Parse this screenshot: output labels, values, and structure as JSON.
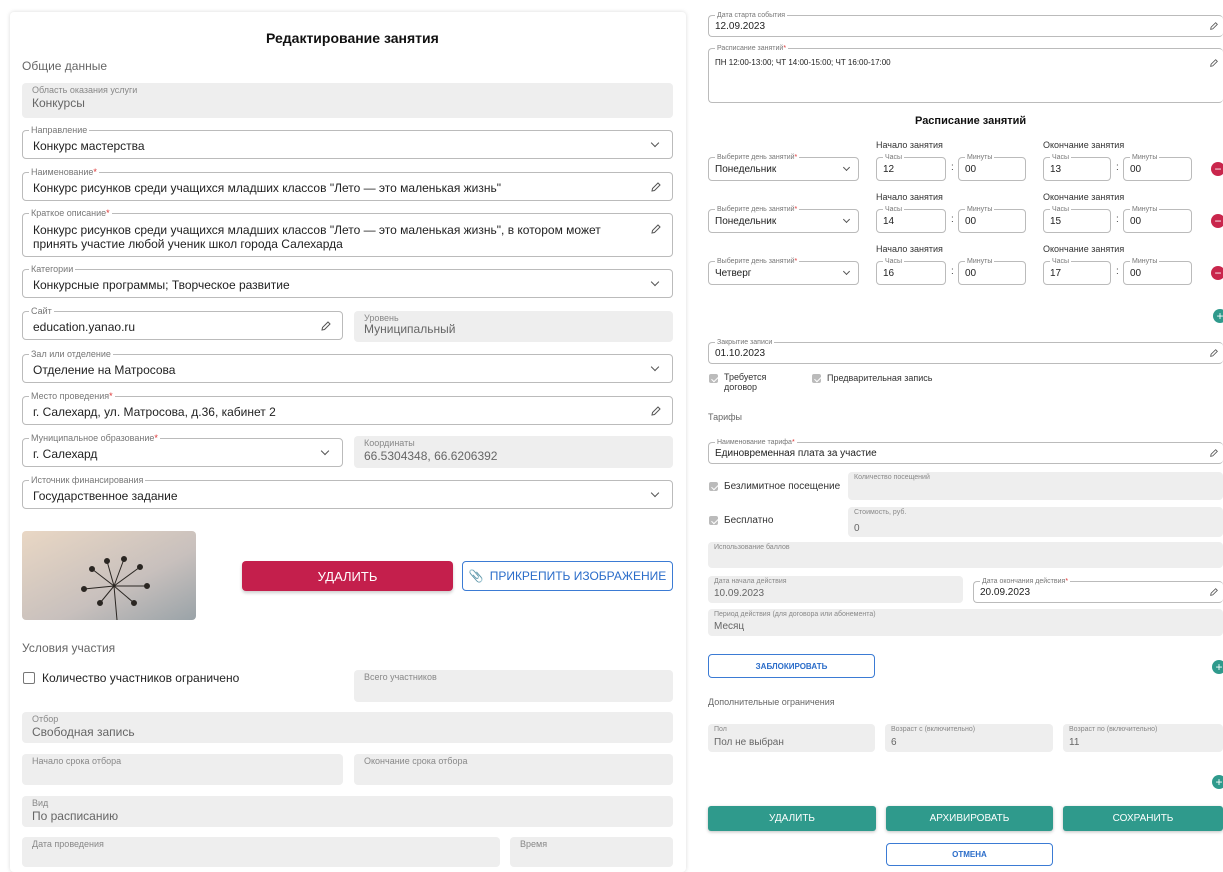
{
  "left": {
    "title": "Редактирование занятия",
    "general_section": "Общие данные",
    "area": {
      "label": "Область оказания услуги",
      "value": "Конкурсы"
    },
    "direction": {
      "label": "Направление",
      "value": "Конкурс мастерства"
    },
    "name": {
      "label": "Наименование",
      "value": "Конкурс рисунков среди учащихся младших классов \"Лето — это маленькая жизнь\""
    },
    "short_desc": {
      "label": "Краткое описание",
      "value": "Конкурс рисунков среди учащихся младших классов \"Лето — это маленькая жизнь\", в котором может принять участие любой ученик школ города Салехарда"
    },
    "categories": {
      "label": "Категории",
      "value": "Конкурсные программы; Творческое развитие"
    },
    "site": {
      "label": "Сайт",
      "value": "education.yanao.ru"
    },
    "level": {
      "label": "Уровень",
      "value": "Муниципальный"
    },
    "hall": {
      "label": "Зал или отделение",
      "value": "Отделение на Матросова"
    },
    "place": {
      "label": "Место проведения",
      "value": "г. Салехард, ул. Матросова, д.36, кабинет 2"
    },
    "municipality": {
      "label": "Муниципальное образование",
      "value": "г. Салехард"
    },
    "coords": {
      "label": "Координаты",
      "value": "66.5304348, 66.6206392"
    },
    "funding": {
      "label": "Источник финансирования",
      "value": "Государственное задание"
    },
    "delete_btn": "УДАЛИТЬ",
    "attach_btn": "ПРИКРЕПИТЬ ИЗОБРАЖЕНИЕ",
    "conditions_section": "Условия участия",
    "limited_label": "Количество участников ограничено",
    "total": {
      "label": "Всего участников",
      "value": ""
    },
    "selection": {
      "label": "Отбор",
      "value": "Свободная запись"
    },
    "sel_start": {
      "label": "Начало срока отбора",
      "value": ""
    },
    "sel_end": {
      "label": "Окончание срока отбора",
      "value": ""
    },
    "kind": {
      "label": "Вид",
      "value": "По расписанию"
    },
    "date": {
      "label": "Дата проведения",
      "value": ""
    },
    "time": {
      "label": "Время",
      "value": ""
    }
  },
  "right": {
    "start_date": {
      "label": "Дата старта события",
      "value": "12.09.2023"
    },
    "schedule": {
      "label": "Расписание занятий",
      "value": "ПН 12:00-13:00; ЧТ 14:00-15:00; ЧТ 16:00-17:00"
    },
    "schedule_title": "Расписание занятий",
    "start_header": "Начало занятия",
    "end_header": "Окончание занятия",
    "day_label": "Выберите день занятий",
    "hours_label": "Часы",
    "minutes_label": "Минуты",
    "rows": [
      {
        "day": "Понедельник",
        "sh": "12",
        "sm": "00",
        "eh": "13",
        "em": "00"
      },
      {
        "day": "Понедельник",
        "sh": "14",
        "sm": "00",
        "eh": "15",
        "em": "00"
      },
      {
        "day": "Четверг",
        "sh": "16",
        "sm": "00",
        "eh": "17",
        "em": "00"
      }
    ],
    "close": {
      "label": "Закрытие записи",
      "value": "01.10.2023"
    },
    "contract_label_1": "Требуется",
    "contract_label_2": "договор",
    "prereg_label": "Предварительная запись",
    "tariffs_section": "Тарифы",
    "tariff_name": {
      "label": "Наименование тарифа",
      "value": "Единовременная плата за участие"
    },
    "unlimited_label": "Безлимитное посещение",
    "visits": {
      "label": "Количество посещений",
      "value": ""
    },
    "free_label": "Бесплатно",
    "cost": {
      "label": "Стоимость, руб.",
      "value": "0"
    },
    "points": {
      "label": "Использование баллов",
      "value": ""
    },
    "valid_from": {
      "label": "Дата начала действия",
      "value": "10.09.2023"
    },
    "valid_to": {
      "label": "Дата окончания действия",
      "value": "20.09.2023"
    },
    "period": {
      "label": "Период действия (для договора или абонемента)",
      "value": "Месяц"
    },
    "block_btn": "ЗАБЛОКИРОВАТЬ",
    "extra_section": "Дополнительные ограничения",
    "sex": {
      "label": "Пол",
      "value": "Пол не выбран"
    },
    "age_from": {
      "label": "Возраст с (включительно)",
      "value": "6"
    },
    "age_to": {
      "label": "Возраст по (включительно)",
      "value": "11"
    },
    "delete_btn": "УДАЛИТЬ",
    "archive_btn": "АРХИВИРОВАТЬ",
    "save_btn": "СОХРАНИТЬ",
    "cancel_btn": "ОТМЕНА"
  },
  "colors": {
    "primary_red": "#c41f4c",
    "teal": "#2f9a8c",
    "blue_outline": "#3b7bd4"
  },
  "icons": [
    "chevron-down-icon",
    "pencil-icon",
    "paperclip-icon",
    "minus-circle-icon",
    "plus-circle-icon",
    "check-icon"
  ]
}
